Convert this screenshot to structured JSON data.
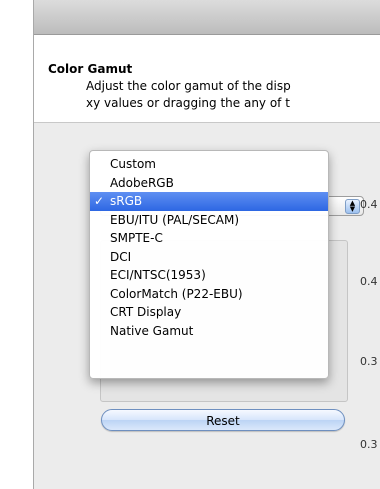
{
  "section": {
    "title": "Color Gamut",
    "description_line1": "Adjust the color gamut of the disp",
    "description_line2": "xy values or dragging the any of t"
  },
  "gamut_menu": {
    "items": [
      {
        "label": "Custom",
        "selected": false
      },
      {
        "label": "AdobeRGB",
        "selected": false
      },
      {
        "label": "sRGB",
        "selected": true
      },
      {
        "label": "EBU/ITU (PAL/SECAM)",
        "selected": false
      },
      {
        "label": "SMPTE-C",
        "selected": false
      },
      {
        "label": "DCI",
        "selected": false
      },
      {
        "label": "ECI/NTSC(1953)",
        "selected": false
      },
      {
        "label": "ColorMatch (P22-EBU)",
        "selected": false
      },
      {
        "label": "CRT Display",
        "selected": false
      },
      {
        "label": "Native Gamut",
        "selected": false
      }
    ],
    "checkmark": "✓",
    "selected_value": "sRGB"
  },
  "popup_arrows_icon": "up-down-arrows-icon",
  "axis_labels": [
    "0.4",
    "0.4",
    "0.3",
    "0.3"
  ],
  "reset_label": "Reset",
  "colors": {
    "menu_highlight": "#3b74e8",
    "reset_button": "#bcd4f5"
  }
}
